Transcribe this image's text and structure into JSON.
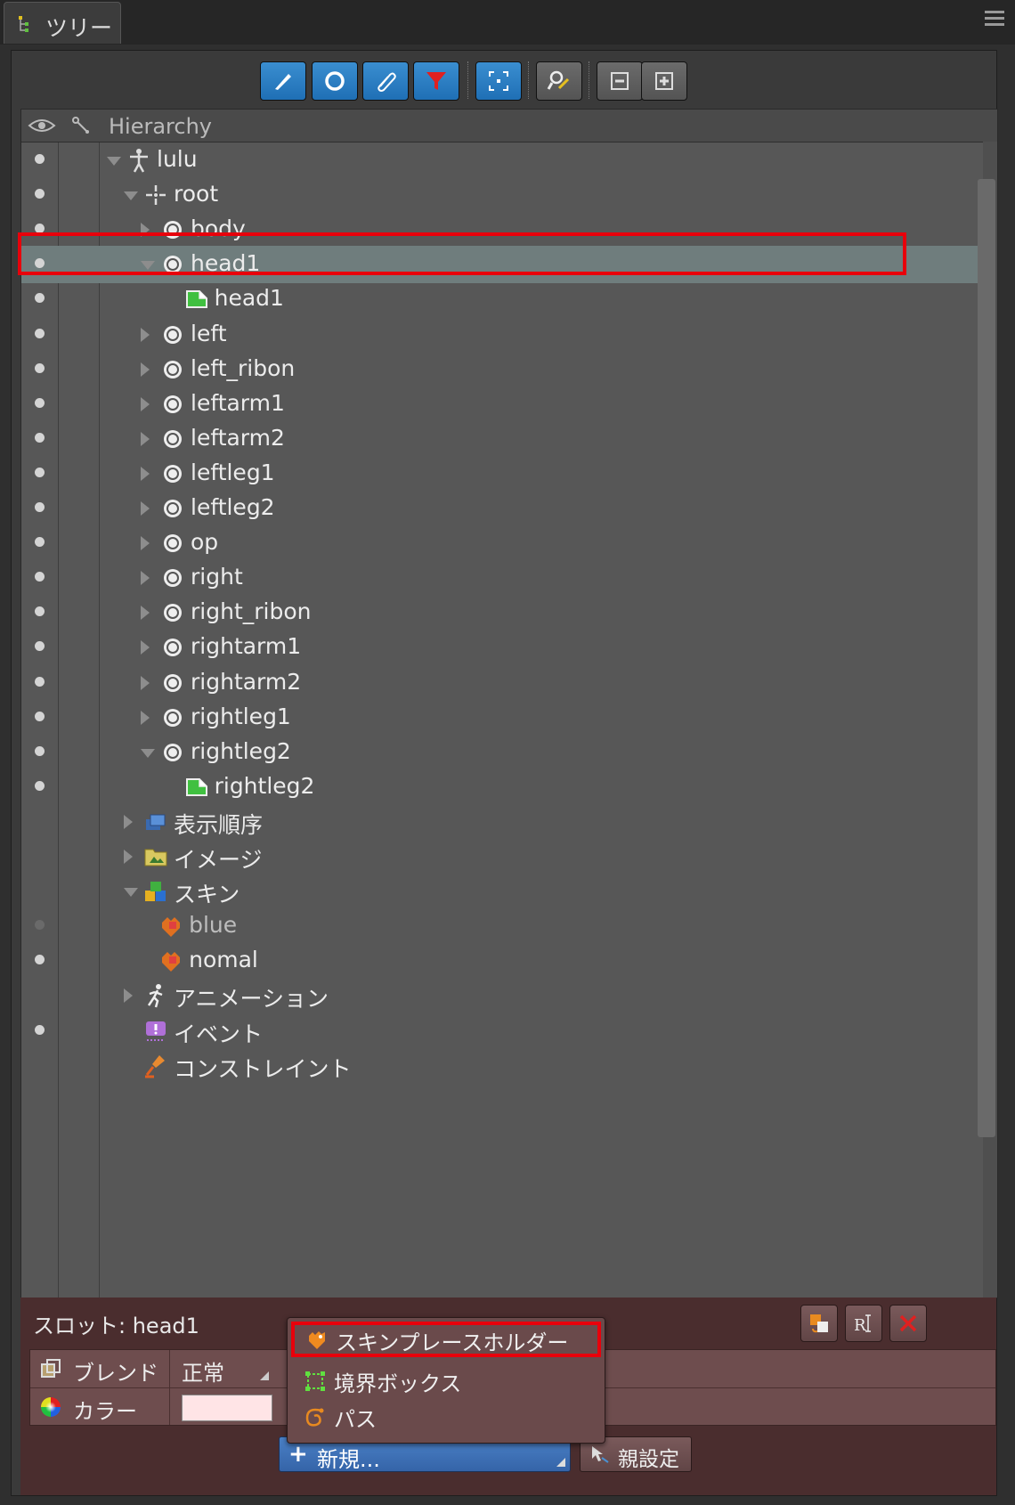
{
  "window": {
    "tab_title": "ツリー"
  },
  "toolbar": {
    "buttons": [
      "bones-toggle",
      "slots-toggle",
      "attachments-toggle",
      "filter",
      "focus",
      "search",
      "collapse",
      "expand"
    ]
  },
  "tree": {
    "header": {
      "eye_icon": "eye-icon",
      "bone_icon": "bone-icon",
      "title": "Hierarchy"
    },
    "rows": [
      {
        "label": "lulu",
        "icon": "skeleton-icon",
        "expander": "down",
        "dot": true
      },
      {
        "label": "root",
        "icon": "root-bone-icon",
        "expander": "down",
        "dot": true
      },
      {
        "label": "body",
        "icon": "bone-icon",
        "expander": "right",
        "dot": true
      },
      {
        "label": "head1",
        "icon": "bone-icon",
        "expander": "down",
        "dot": true,
        "selected": true
      },
      {
        "label": "head1",
        "icon": "region-attachment-icon",
        "expander": "none",
        "dot": true
      },
      {
        "label": "left",
        "icon": "bone-icon",
        "expander": "right",
        "dot": true
      },
      {
        "label": "left_ribon",
        "icon": "bone-icon",
        "expander": "right",
        "dot": true
      },
      {
        "label": "leftarm1",
        "icon": "bone-icon",
        "expander": "right",
        "dot": true
      },
      {
        "label": "leftarm2",
        "icon": "bone-icon",
        "expander": "right",
        "dot": true
      },
      {
        "label": "leftleg1",
        "icon": "bone-icon",
        "expander": "right",
        "dot": true
      },
      {
        "label": "leftleg2",
        "icon": "bone-icon",
        "expander": "right",
        "dot": true
      },
      {
        "label": "op",
        "icon": "bone-icon",
        "expander": "right",
        "dot": true
      },
      {
        "label": "right",
        "icon": "bone-icon",
        "expander": "right",
        "dot": true
      },
      {
        "label": "right_ribon",
        "icon": "bone-icon",
        "expander": "right",
        "dot": true
      },
      {
        "label": "rightarm1",
        "icon": "bone-icon",
        "expander": "right",
        "dot": true
      },
      {
        "label": "rightarm2",
        "icon": "bone-icon",
        "expander": "right",
        "dot": true
      },
      {
        "label": "rightleg1",
        "icon": "bone-icon",
        "expander": "right",
        "dot": true
      },
      {
        "label": "rightleg2",
        "icon": "bone-icon",
        "expander": "down",
        "dot": true
      },
      {
        "label": "rightleg2",
        "icon": "region-attachment-icon",
        "expander": "none",
        "dot": true
      },
      {
        "label": "表示順序",
        "icon": "draw-order-icon",
        "expander": "right",
        "dot": false
      },
      {
        "label": "イメージ",
        "icon": "images-folder-icon",
        "expander": "right",
        "dot": false
      },
      {
        "label": "スキン",
        "icon": "skins-icon",
        "expander": "down",
        "dot": false
      },
      {
        "label": "blue",
        "icon": "skin-icon",
        "expander": "none",
        "dot": "dim",
        "dim": true
      },
      {
        "label": "nomal",
        "icon": "skin-icon",
        "expander": "none",
        "dot": true
      },
      {
        "label": "アニメーション",
        "icon": "animation-icon",
        "expander": "right",
        "dot": false
      },
      {
        "label": "イベント",
        "icon": "event-icon",
        "expander": "none",
        "dot": true
      },
      {
        "label": "コンストレイント",
        "icon": "constraint-icon",
        "expander": "none",
        "dot": false
      }
    ]
  },
  "slot": {
    "title": "スロット: head1",
    "properties": [
      {
        "label": "ブレンド",
        "value": "正常",
        "icon": "blend-icon"
      },
      {
        "label": "カラー",
        "value": "",
        "icon": "color-wheel-icon",
        "swatch": "#ffe4e6"
      }
    ],
    "new_button": "新規...",
    "parent_button": "親設定"
  },
  "popup_menu": {
    "items": [
      {
        "label": "スキンプレースホルダー",
        "icon": "skin-placeholder-icon",
        "highlighted": true
      },
      {
        "label": "境界ボックス",
        "icon": "bounding-box-icon"
      },
      {
        "label": "パス",
        "icon": "path-icon"
      }
    ]
  },
  "colors": {
    "selection": "#6f7d7d",
    "highlight_border": "#e8000b",
    "toolbar_blue": "#1f6fb5",
    "slot_panel": "#4a2d2e"
  }
}
